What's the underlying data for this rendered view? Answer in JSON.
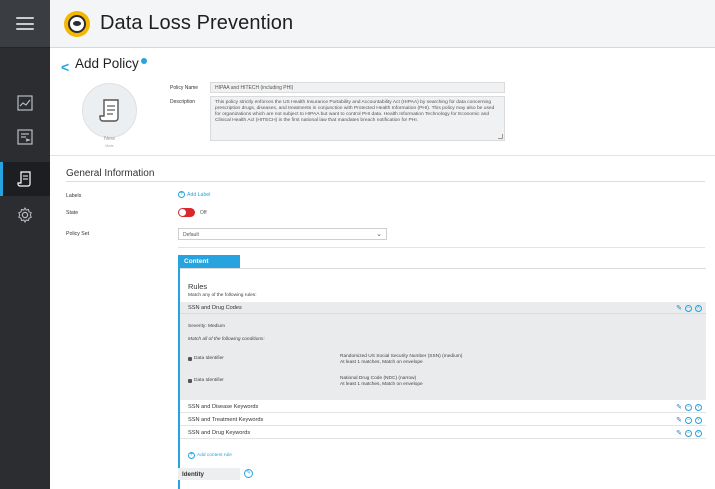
{
  "app": {
    "title": "Data Loss Prevention"
  },
  "page": {
    "title": "Add Policy"
  },
  "policy": {
    "badge_status": "New",
    "badge_mode": "Mode",
    "name_label": "Policy Name",
    "name_value": "HIPAA and HITECH (including PHI)",
    "description_label": "Description",
    "description_value": "This policy strictly enforces the US Health Insurance Portability and Accountability Act (HIPAA) by searching for data concerning prescription drugs, diseases, and treatments in conjunction with Protected Health Information (PHI). This policy may also be used for organizations which are not subject to HIPAA but want to control PHI data. Health Information Technology for Economic and Clinical Health Act (HITECH) is the first national law that mandates breach notification for PHI."
  },
  "general": {
    "title": "General Information",
    "labels_label": "Labels",
    "add_label": "Add Label",
    "state_label": "State",
    "state_value": "Off",
    "policy_set_label": "Policy Set",
    "policy_set_value": "Default"
  },
  "content": {
    "tab_label": "Content",
    "rules_title": "Rules",
    "rules_subtitle": "Match any of the following rules:",
    "expanded_rule": {
      "name": "SSN and Drug Codes",
      "severity": "Severity: Medium",
      "match_all": "Match all of the following conditions:",
      "conditions": [
        {
          "type": "Data Identifier",
          "line1": "Randomized US Social Security Number (SSN) (medium)",
          "line2": "At least 1 matches, Match on envelope"
        },
        {
          "type": "Data Identifier",
          "line1": "National Drug Code (NDC) (narrow)",
          "line2": "At least 1 matches, Match on envelope"
        }
      ]
    },
    "rules": [
      {
        "name": "SSN and Disease Keywords"
      },
      {
        "name": "SSN and Treatment Keywords"
      },
      {
        "name": "SSN and Drug Keywords"
      }
    ],
    "add_rule": "Add content rule"
  },
  "identity": {
    "tab_label": "Identity"
  },
  "colors": {
    "accent": "#27a3e0",
    "rail": "#2b2d31",
    "toggle_off": "#d9272e",
    "logo": "#f5b800"
  }
}
